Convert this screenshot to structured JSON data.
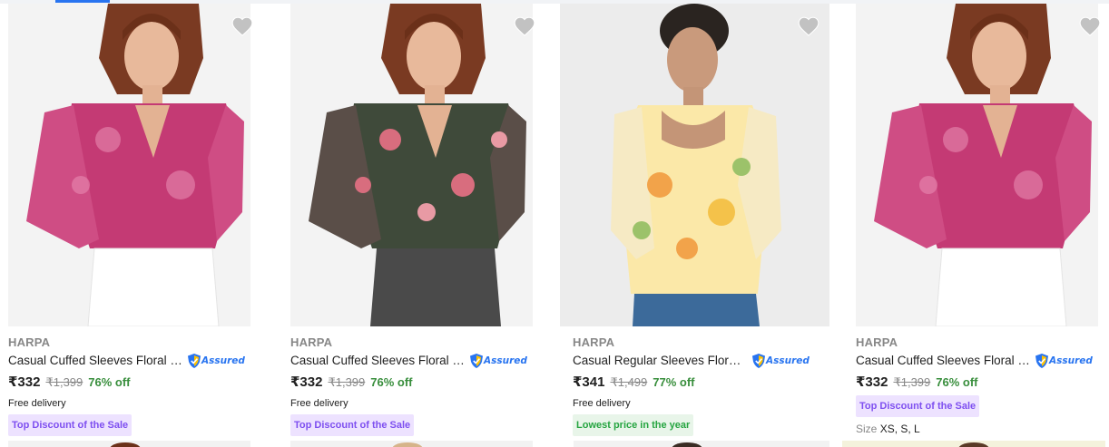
{
  "wishlist_icon": "heart-icon",
  "assured_icon": "shield-check-icon",
  "colors": {
    "price_off": "#388e3c",
    "assured_blue": "#2874f0",
    "badge_purple_bg": "#ede2ff",
    "badge_purple_text": "#7e4ff0",
    "badge_green_bg": "#e8f5e9",
    "badge_green_text": "#26a541"
  },
  "products": [
    {
      "brand": "HARPA",
      "title": "Casual Cuffed Sleeves Floral Print Women Pink Top",
      "assured": "Assured",
      "price": "₹332",
      "mrp": "₹1,399",
      "discount": "76% off",
      "delivery": "Free delivery",
      "badge": "Top Discount of the Sale"
    },
    {
      "brand": "HARPA",
      "title": "Casual Cuffed Sleeves Floral Print Women Multicolor Top",
      "assured": "Assured",
      "price": "₹332",
      "mrp": "₹1,399",
      "discount": "76% off",
      "delivery": "Free delivery",
      "badge": "Top Discount of the Sale"
    },
    {
      "brand": "HARPA",
      "title": "Casual Regular Sleeves Floral Print Women Yellow Top",
      "assured": "Assured",
      "price": "₹341",
      "mrp": "₹1,499",
      "discount": "77% off",
      "delivery": "Free delivery",
      "badge": "Lowest price in the year"
    },
    {
      "brand": "HARPA",
      "title": "Casual Cuffed Sleeves Floral Print Women Pink Top",
      "assured": "Assured",
      "price": "₹332",
      "mrp": "₹1,399",
      "discount": "76% off",
      "badge": "Top Discount of the Sale",
      "size_label": "Size",
      "sizes": "XS, S, L"
    }
  ]
}
